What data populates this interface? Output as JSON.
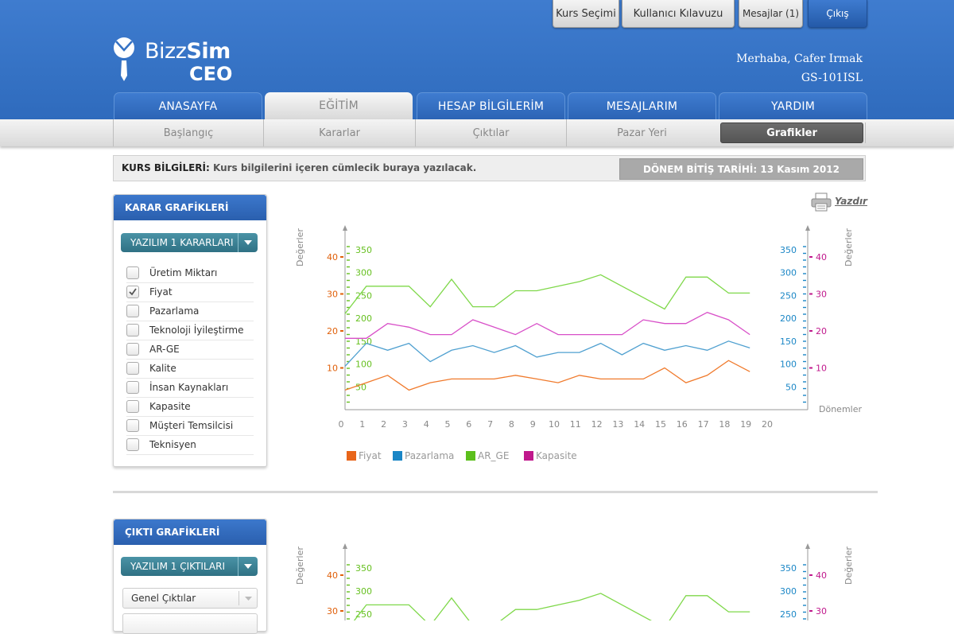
{
  "top_buttons": {
    "course": "Kurs Seçimi",
    "manual": "Kullanıcı Kılavuzu",
    "messages": "Mesajlar (1)",
    "logout": "Çıkış"
  },
  "brand": {
    "bizz": "Bizz",
    "sim": "Sim",
    "ceo": "CEO"
  },
  "user": {
    "greeting": "Merhaba, Cafer Irmak",
    "code": "GS-101ISL"
  },
  "nav": [
    "ANASAYFA",
    "EĞİTİM",
    "HESAP BİLGİLERİM",
    "MESAJLARIM",
    "YARDIM"
  ],
  "subnav": [
    "Başlangıç",
    "Kararlar",
    "Çıktılar",
    "Pazar Yeri",
    "Grafikler"
  ],
  "info": {
    "label": "KURS BİLGİLERİ:",
    "text": "Kurs bilgilerini içeren cümlecik buraya yazılacak.",
    "date": "DÖNEM BİTİŞ TARİHİ: 13 Kasım 2012"
  },
  "print_label": "Yazdır",
  "panel1": {
    "title": "KARAR GRAFİKLERİ",
    "dropdown": "YAZILIM 1 KARARLARI",
    "items": [
      {
        "label": "Üretim Miktarı",
        "checked": false
      },
      {
        "label": "Fiyat",
        "checked": true
      },
      {
        "label": "Pazarlama",
        "checked": false
      },
      {
        "label": "Teknoloji İyileştirme",
        "checked": false
      },
      {
        "label": "AR-GE",
        "checked": false
      },
      {
        "label": "Kalite",
        "checked": false
      },
      {
        "label": "İnsan Kaynakları",
        "checked": false
      },
      {
        "label": "Kapasite",
        "checked": false
      },
      {
        "label": "Müşteri  Temsilcisi",
        "checked": false
      },
      {
        "label": "Teknisyen",
        "checked": false
      }
    ]
  },
  "panel2": {
    "title": "ÇIKTI GRAFİKLERİ",
    "dropdown": "YAZILIM 1 ÇIKTILARI",
    "select1": "Genel Çıktılar"
  },
  "chart_data": {
    "type": "line",
    "ylabel_left": "Değerler",
    "ylabel_right": "Değerler",
    "xlabel": "Dönemler",
    "x": [
      0,
      1,
      2,
      3,
      4,
      5,
      6,
      7,
      8,
      9,
      10,
      11,
      12,
      13,
      14,
      15,
      16,
      17,
      18,
      19,
      20
    ],
    "axis_left_outer": {
      "ticks": [
        10,
        20,
        30,
        40
      ],
      "color": "#e0600a"
    },
    "axis_left_inner": {
      "ticks": [
        50,
        100,
        150,
        200,
        250,
        300,
        350
      ],
      "color": "#66c020"
    },
    "axis_right_inner": {
      "ticks": [
        50,
        100,
        150,
        200,
        250,
        300,
        350
      ],
      "color": "#1a86c6"
    },
    "axis_right_outer": {
      "ticks": [
        10,
        20,
        30,
        40
      ],
      "color": "#c0188c"
    },
    "series": [
      {
        "name": "Fiyat",
        "axis": "left_outer",
        "color": "#f07a2c",
        "values": [
          4,
          6,
          8,
          4,
          6,
          7,
          7,
          7,
          8,
          7,
          6,
          8,
          7,
          7,
          7,
          10,
          6,
          8,
          12,
          9
        ]
      },
      {
        "name": "Pazarlama",
        "axis": "right_inner",
        "color": "#4fa0d0",
        "values": [
          95,
          145,
          130,
          145,
          105,
          130,
          140,
          125,
          140,
          115,
          125,
          125,
          145,
          120,
          145,
          130,
          140,
          130,
          150,
          135
        ]
      },
      {
        "name": "AR_GE",
        "axis": "left_inner",
        "color": "#7fd84a",
        "values": [
          210,
          270,
          270,
          270,
          225,
          285,
          225,
          225,
          260,
          260,
          270,
          280,
          295,
          270,
          245,
          220,
          290,
          290,
          255,
          255
        ]
      },
      {
        "name": "Kapasite",
        "axis": "right_outer",
        "color": "#d84fc8",
        "values": [
          18,
          18,
          22,
          21,
          19,
          19,
          23,
          21,
          19,
          22,
          19,
          19,
          19,
          19,
          23,
          22,
          22,
          25,
          23,
          19
        ]
      }
    ]
  }
}
